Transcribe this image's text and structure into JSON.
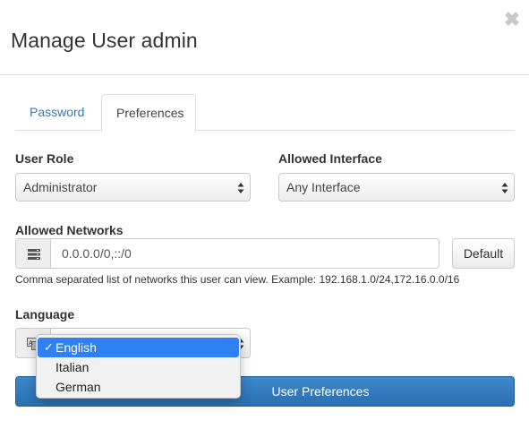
{
  "modal": {
    "title": "Manage User admin",
    "close_glyph": "✖"
  },
  "tabs": [
    {
      "label": "Password",
      "active": false
    },
    {
      "label": "Preferences",
      "active": true
    }
  ],
  "form": {
    "user_role": {
      "label": "User Role",
      "value": "Administrator"
    },
    "allowed_interface": {
      "label": "Allowed Interface",
      "value": "Any Interface"
    },
    "allowed_networks": {
      "label": "Allowed Networks",
      "value": "0.0.0.0/0,::/0",
      "default_button": "Default",
      "help": "Comma separated list of networks this user can view. Example: 192.168.1.0/24,172.16.0.0/16"
    },
    "language": {
      "label": "Language",
      "options": [
        "English",
        "Italian",
        "German"
      ],
      "selected": "English",
      "check_glyph": "✓"
    }
  },
  "save_button": {
    "label": "User Preferences"
  },
  "icons": {
    "network": "server-icon",
    "language": "language-icon",
    "select_arrows": "updown-arrows-icon",
    "close": "close-icon"
  },
  "colors": {
    "accent": "#337ab7",
    "primary_button": "#2f7ab9",
    "dropdown_highlight": "#2f7ff5"
  }
}
